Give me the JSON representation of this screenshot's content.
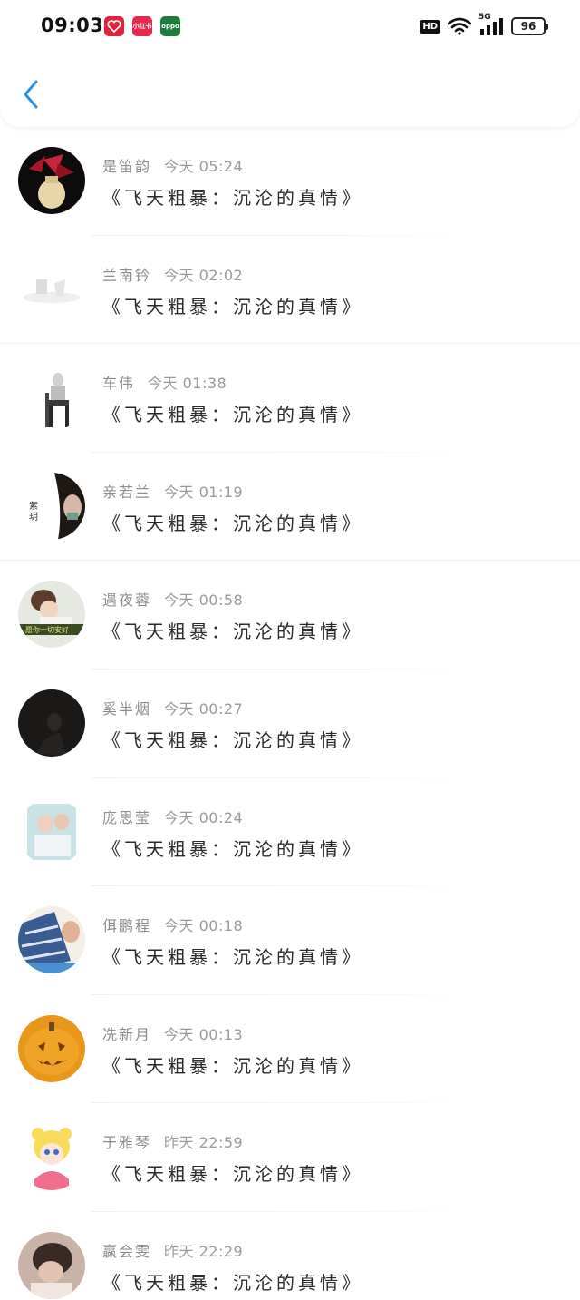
{
  "status_bar": {
    "time": "09:03",
    "badges": [
      "",
      "小红书",
      "oppo"
    ],
    "hd": "HD",
    "signal": "5G",
    "battery": "96"
  },
  "header": {
    "back_icon": "chevron-left-icon",
    "accent": "#2b93e6"
  },
  "items": [
    {
      "name": "是笛韵",
      "time": "今天 05:24",
      "title": "《飞天粗暴：沉沦的真情》"
    },
    {
      "name": "兰南钤",
      "time": "今天 02:02",
      "title": "《飞天粗暴：沉沦的真情》"
    },
    {
      "name": "车伟",
      "time": "今天 01:38",
      "title": "《飞天粗暴：沉沦的真情》"
    },
    {
      "name": "亲若兰",
      "time": "今天 01:19",
      "title": "《飞天粗暴：沉沦的真情》"
    },
    {
      "name": "遇夜蓉",
      "time": "今天 00:58",
      "title": "《飞天粗暴：沉沦的真情》"
    },
    {
      "name": "奚半烟",
      "time": "今天 00:27",
      "title": "《飞天粗暴：沉沦的真情》"
    },
    {
      "name": "庞思莹",
      "time": "今天 00:24",
      "title": "《飞天粗暴：沉沦的真情》"
    },
    {
      "name": "佴鹏程",
      "time": "今天 00:18",
      "title": "《飞天粗暴：沉沦的真情》"
    },
    {
      "name": "冼新月",
      "time": "今天 00:13",
      "title": "《飞天粗暴：沉沦的真情》"
    },
    {
      "name": "于雅琴",
      "time": "昨天 22:59",
      "title": "《飞天粗暴：沉沦的真情》"
    },
    {
      "name": "嬴会雯",
      "time": "昨天 22:29",
      "title": "《飞天粗暴：沉沦的真情》"
    }
  ]
}
